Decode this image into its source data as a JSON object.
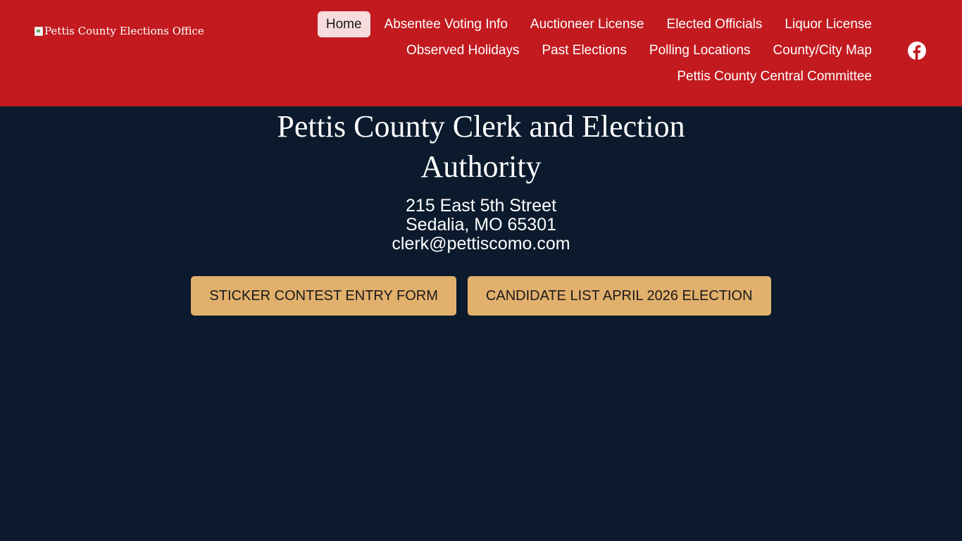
{
  "header": {
    "logo_alt": "Pettis County Elections Office",
    "nav": {
      "row1": [
        {
          "label": "Home",
          "active": true
        },
        {
          "label": "Absentee Voting Info"
        },
        {
          "label": "Auctioneer License"
        },
        {
          "label": "Elected Officials"
        },
        {
          "label": "Liquor License"
        }
      ],
      "row2": [
        {
          "label": "Observed Holidays"
        },
        {
          "label": "Past Elections"
        },
        {
          "label": "Polling Locations"
        },
        {
          "label": "County/City Map"
        }
      ],
      "row3": [
        {
          "label": "Pettis County Central Committee"
        }
      ]
    },
    "social_icon": "facebook-icon"
  },
  "hero": {
    "title": "Pettis County Clerk and Election Authority",
    "address_line1": "215 East 5th Street",
    "address_line2": "Sedalia, MO 65301",
    "email": "clerk@pettiscomo.com"
  },
  "buttons": {
    "sticker": "STICKER CONTEST ENTRY FORM",
    "candidate": "CANDIDATE LIST APRIL 2026 ELECTION"
  },
  "colors": {
    "header_bg": "#c21a1f",
    "page_bg": "#0b1a2c",
    "button_bg": "#e2b06d",
    "active_nav_bg": "#f6dcdc"
  }
}
